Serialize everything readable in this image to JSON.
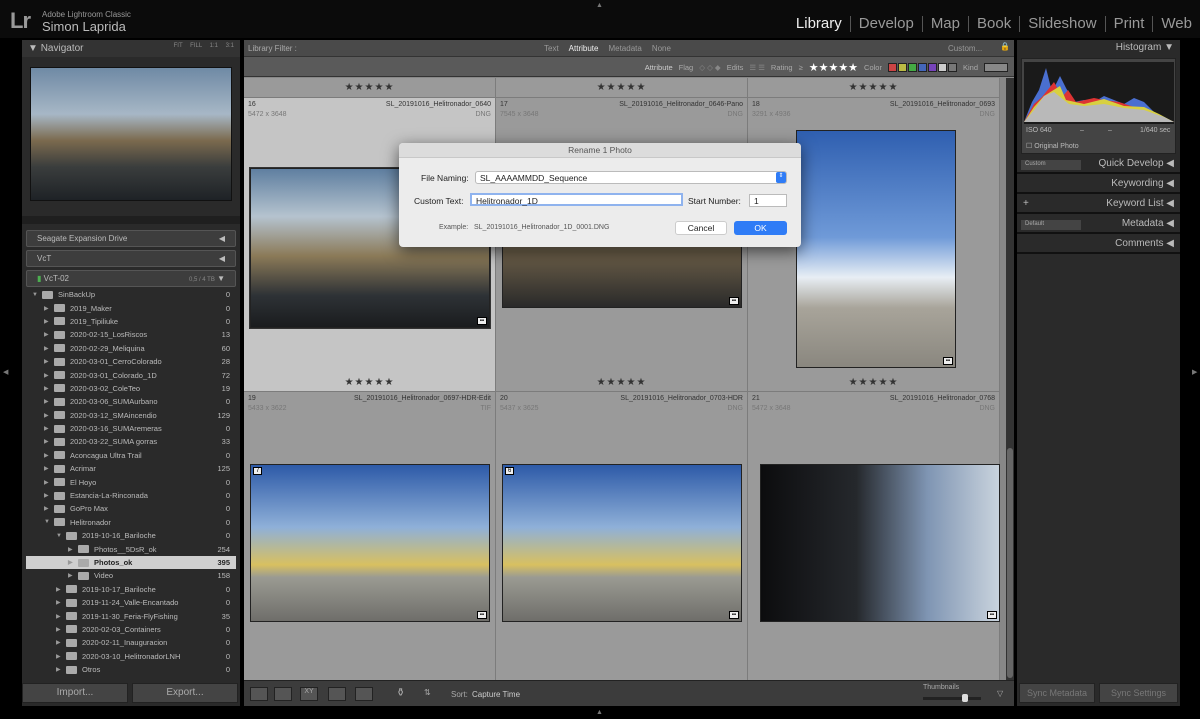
{
  "app": {
    "name": "Adobe Lightroom Classic",
    "user": "Simon Laprida"
  },
  "modules": [
    "Library",
    "Develop",
    "Map",
    "Book",
    "Slideshow",
    "Print",
    "Web"
  ],
  "navigator": {
    "title": "Navigator",
    "zoom": [
      "FIT",
      "FILL",
      "1:1",
      "3:1"
    ]
  },
  "drives": [
    {
      "name": "Seagate Expansion Drive"
    },
    {
      "name": "VcT"
    },
    {
      "name": "VcT-02",
      "space": "0,5 / 4 TB",
      "status_color": "#4caf50"
    }
  ],
  "folders": [
    {
      "name": "SinBackUp",
      "count": "0",
      "level": 0,
      "expanded": true
    },
    {
      "name": "2019_Maker",
      "count": "0",
      "level": 1
    },
    {
      "name": "2019_Tipiliuke",
      "count": "0",
      "level": 1
    },
    {
      "name": "2020-02-15_LosRiscos",
      "count": "13",
      "level": 1
    },
    {
      "name": "2020-02-29_Meliquina",
      "count": "60",
      "level": 1
    },
    {
      "name": "2020-03-01_CerroColorado",
      "count": "28",
      "level": 1
    },
    {
      "name": "2020-03-01_Colorado_1D",
      "count": "72",
      "level": 1
    },
    {
      "name": "2020-03-02_ColeTeo",
      "count": "19",
      "level": 1
    },
    {
      "name": "2020-03-06_SUMAurbano",
      "count": "0",
      "level": 1
    },
    {
      "name": "2020-03-12_SMAincendio",
      "count": "129",
      "level": 1
    },
    {
      "name": "2020-03-16_SUMAremeras",
      "count": "0",
      "level": 1
    },
    {
      "name": "2020-03-22_SUMA gorras",
      "count": "33",
      "level": 1
    },
    {
      "name": "Aconcagua Ultra Trail",
      "count": "0",
      "level": 1
    },
    {
      "name": "Acrimar",
      "count": "125",
      "level": 1
    },
    {
      "name": "El Hoyo",
      "count": "0",
      "level": 1
    },
    {
      "name": "Estancia-La-Rinconada",
      "count": "0",
      "level": 1
    },
    {
      "name": "GoPro Max",
      "count": "0",
      "level": 1
    },
    {
      "name": "Helitronador",
      "count": "0",
      "level": 1,
      "expanded": true
    },
    {
      "name": "2019-10-16_Bariloche",
      "count": "0",
      "level": 2,
      "expanded": true
    },
    {
      "name": "Photos__5DsR_ok",
      "count": "254",
      "level": 3
    },
    {
      "name": "Photos_ok",
      "count": "395",
      "level": 3,
      "selected": true
    },
    {
      "name": "Video",
      "count": "158",
      "level": 3
    },
    {
      "name": "2019-10-17_Bariloche",
      "count": "0",
      "level": 2
    },
    {
      "name": "2019-11-24_Valle-Encantado",
      "count": "0",
      "level": 2
    },
    {
      "name": "2019-11-30_Feria-FlyFishing",
      "count": "35",
      "level": 2
    },
    {
      "name": "2020-02-03_Containers",
      "count": "0",
      "level": 2
    },
    {
      "name": "2020-02-11_Inauguracion",
      "count": "0",
      "level": 2
    },
    {
      "name": "2020-03-10_HelitronadorLNH",
      "count": "0",
      "level": 2
    },
    {
      "name": "Otros",
      "count": "0",
      "level": 2
    }
  ],
  "left_buttons": {
    "import": "Import...",
    "export": "Export..."
  },
  "filter": {
    "label": "Library Filter :",
    "tabs": [
      "Text",
      "Attribute",
      "Metadata",
      "None"
    ],
    "active": "Attribute",
    "preset": "Custom...",
    "attribute_label": "Attribute",
    "flag": "Flag",
    "edits": "Edits",
    "rating": "Rating",
    "rating_op": "≥",
    "rating_value": 5,
    "color": "Color",
    "kind": "Kind",
    "colors": [
      "#c44",
      "#bb4",
      "#4a4",
      "#46b",
      "#74b",
      "#ccc",
      "#777"
    ]
  },
  "grid": {
    "top_stars": "★★★★★",
    "photos": [
      {
        "index": "16",
        "name": "SL_20191016_Helitronador_0640",
        "dims": "5472 x 3648",
        "ext": "DNG",
        "stars": "★★★★★",
        "selected": true
      },
      {
        "index": "17",
        "name": "SL_20191016_Helitronador_0646-Pano",
        "dims": "7545 x 3648",
        "ext": "DNG",
        "stars": "★★★★★"
      },
      {
        "index": "18",
        "name": "SL_20191016_Helitronador_0693",
        "dims": "3291 x 4936",
        "ext": "DNG",
        "stars": "★★★★★"
      },
      {
        "index": "19",
        "name": "SL_20191016_Helitronador_0697-HDR-Edit",
        "dims": "5433 x 3622",
        "ext": "TIF",
        "badge": "7"
      },
      {
        "index": "20",
        "name": "SL_20191016_Helitronador_0703-HDR",
        "dims": "5437 x 3625",
        "ext": "DNG",
        "badge": "6"
      },
      {
        "index": "21",
        "name": "SL_20191016_Helitronador_0768",
        "dims": "5472 x 3648",
        "ext": "DNG"
      }
    ]
  },
  "toolbar": {
    "sort_label": "Sort:",
    "sort_value": "Capture Time",
    "thumbnails": "Thumbnails",
    "thumb_size": 0.75
  },
  "right": {
    "histogram": "Histogram",
    "iso": "ISO 640",
    "dash1": "–",
    "dash2": "–",
    "shutter": "1/640 sec",
    "original_photo": "Original Photo",
    "sections": [
      {
        "title": "Quick Develop",
        "select": "Custom"
      },
      {
        "title": "Keywording"
      },
      {
        "title": "Keyword List",
        "plus": "+"
      },
      {
        "title": "Metadata",
        "select": "Default"
      },
      {
        "title": "Comments"
      }
    ],
    "sync_metadata": "Sync Metadata",
    "sync_settings": "Sync Settings"
  },
  "dialog": {
    "title": "Rename 1 Photo",
    "file_naming_label": "File Naming:",
    "file_naming_value": "SL_AAAAMMDD_Sequence",
    "custom_text_label": "Custom Text:",
    "custom_text_value": "Helitronador_1D",
    "start_number_label": "Start Number:",
    "start_number_value": "1",
    "example_label": "Example:",
    "example_value": "SL_20191016_Helitronador_1D_0001.DNG",
    "cancel": "Cancel",
    "ok": "OK",
    "accent": "#2f7cf6"
  }
}
